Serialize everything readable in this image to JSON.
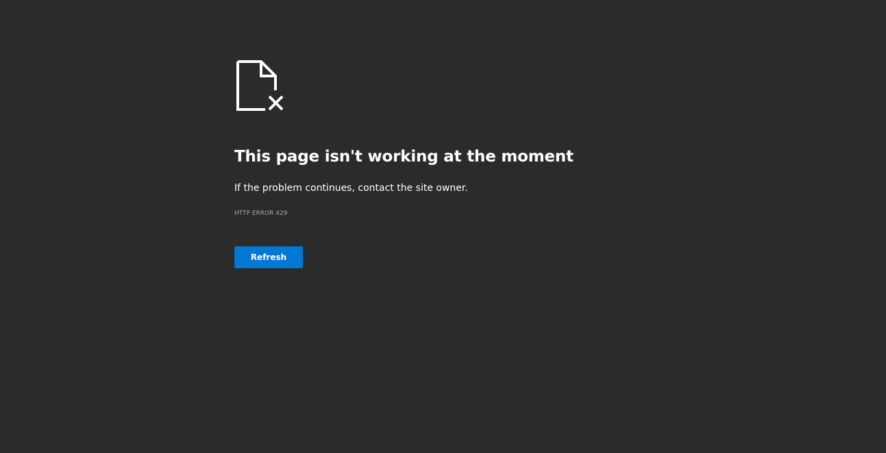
{
  "error": {
    "icon": "document-error-icon",
    "title": "This page isn't working at the moment",
    "message": "If the problem continues, contact the site owner.",
    "code": "HTTP ERROR 429"
  },
  "actions": {
    "refresh_label": "Refresh"
  },
  "colors": {
    "background": "#2b2b2b",
    "text": "#ffffff",
    "muted": "#a9a9a9",
    "accent": "#0078d4"
  }
}
